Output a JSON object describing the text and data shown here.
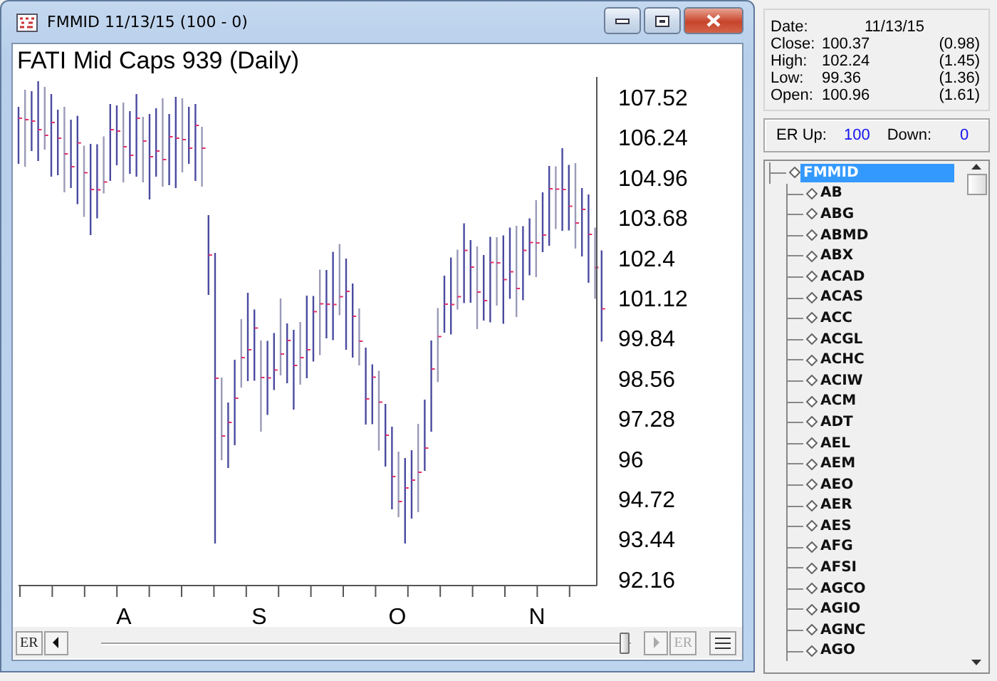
{
  "window": {
    "title": "FMMID 11/13/15 (100 - 0)"
  },
  "chart": {
    "title": "FATI Mid Caps 939 (Daily)",
    "price_axis": [
      "107.52",
      "106.24",
      "104.96",
      "103.68",
      "102.4",
      "101.12",
      "99.84",
      "98.56",
      "97.28",
      "96",
      "94.72",
      "93.44",
      "92.16"
    ],
    "month_axis": [
      "A",
      "S",
      "O",
      "N"
    ]
  },
  "nav": {
    "er_left": {
      "label": "ER",
      "disabled": false
    },
    "back": {
      "disabled": false
    },
    "slider": {
      "level": 0.99
    },
    "forward": {
      "disabled": true
    },
    "er_right": {
      "label": "ER",
      "disabled": true
    }
  },
  "quote": {
    "date": {
      "label": "Date:",
      "value": "11/13/15"
    },
    "rows": [
      {
        "label": "Close:",
        "value": "100.37",
        "change": "(0.98)"
      },
      {
        "label": "High:",
        "value": "102.24",
        "change": "(1.45)"
      },
      {
        "label": "Low:",
        "value": "99.36",
        "change": "(1.36)"
      },
      {
        "label": "Open:",
        "value": "100.96",
        "change": "(1.61)"
      }
    ]
  },
  "er": {
    "up_label": "ER Up:",
    "up_value": "100",
    "down_label": "Down:",
    "down_value": "0"
  },
  "tree": {
    "label": "FMMID",
    "selected": true,
    "children": [
      {
        "label": "AB",
        "selected": false
      },
      {
        "label": "ABG",
        "selected": false
      },
      {
        "label": "ABMD",
        "selected": false
      },
      {
        "label": "ABX",
        "selected": false
      },
      {
        "label": "ACAD",
        "selected": false
      },
      {
        "label": "ACAS",
        "selected": false
      },
      {
        "label": "ACC",
        "selected": false
      },
      {
        "label": "ACGL",
        "selected": false
      },
      {
        "label": "ACHC",
        "selected": false
      },
      {
        "label": "ACIW",
        "selected": false
      },
      {
        "label": "ACM",
        "selected": false
      },
      {
        "label": "ADT",
        "selected": false
      },
      {
        "label": "AEL",
        "selected": false
      },
      {
        "label": "AEM",
        "selected": false
      },
      {
        "label": "AEO",
        "selected": false
      },
      {
        "label": "AER",
        "selected": false
      },
      {
        "label": "AES",
        "selected": false
      },
      {
        "label": "AFG",
        "selected": false
      },
      {
        "label": "AFSI",
        "selected": false
      },
      {
        "label": "AGCO",
        "selected": false
      },
      {
        "label": "AGIO",
        "selected": false
      },
      {
        "label": "AGNC",
        "selected": false
      },
      {
        "label": "AGO",
        "selected": false
      }
    ]
  }
}
